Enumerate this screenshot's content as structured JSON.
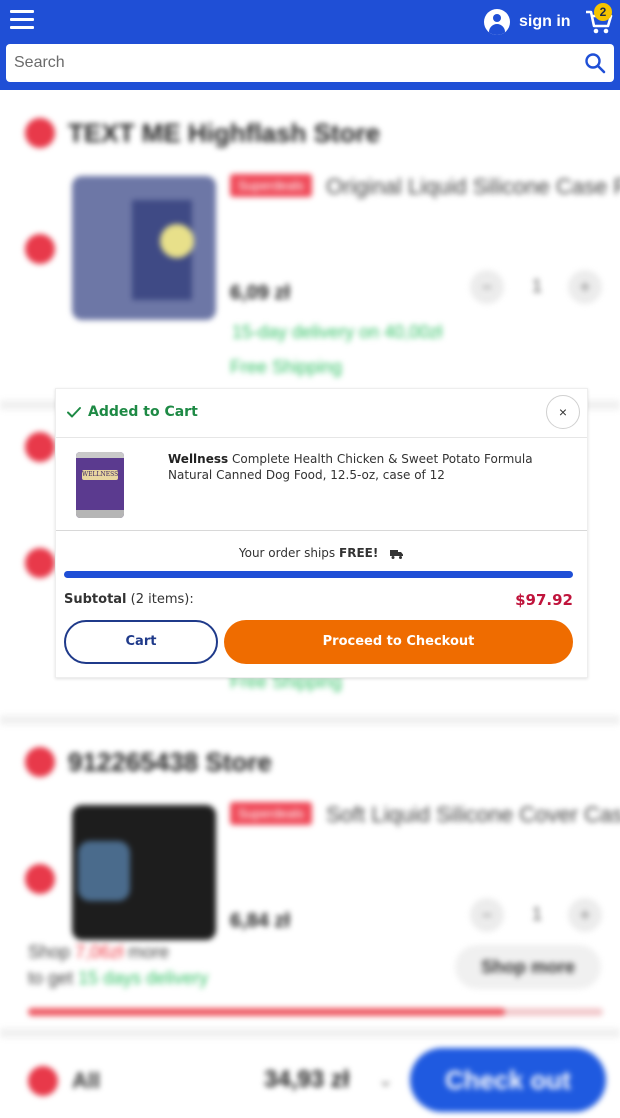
{
  "header": {
    "menu_icon": "hamburger-menu-icon",
    "signin_label": "sign in",
    "cart_count": "2",
    "search_placeholder": "Search"
  },
  "background": {
    "store1": {
      "name": "TEXT ME Highflash Store",
      "tag": "Superdeals",
      "product_title": "Original Liquid Silicone Case F...",
      "price": "6,09 zł",
      "qty": "1",
      "delivery": "15-day delivery on 40,00zł",
      "shipping": "Free Shipping"
    },
    "store2": {
      "shipping": "Free Shipping"
    },
    "store3": {
      "name": "912265438 Store",
      "tag": "Superdeals",
      "product_title": "Soft Liquid Silicone Cover Cas...",
      "price": "6,84 zł",
      "qty": "1"
    },
    "promo": {
      "line1_prefix": "Shop",
      "line1_amount": "7,06zł",
      "line1_suffix": "more",
      "line2_prefix": "to get",
      "line2_delivery": "15 days delivery",
      "shop_more": "Shop more",
      "progress_fraction": 0.83
    },
    "footer": {
      "all_label": "All",
      "total": "34,93 zł",
      "checkout_label": "Check out"
    }
  },
  "modal": {
    "title": "Added to Cart",
    "close_label": "×",
    "product": {
      "brand": "Wellness",
      "description": "Complete Health Chicken & Sweet Potato Formula Natural Canned Dog Food, 12.5-oz, case of 12",
      "image_label": "WELLNESS"
    },
    "ships_prefix": "Your order ships",
    "ships_free": "FREE!",
    "subtotal_label": "Subtotal",
    "subtotal_items": "(2 items):",
    "subtotal_amount": "$97.92",
    "cart_button": "Cart",
    "checkout_button": "Proceed to Checkout"
  },
  "colors": {
    "header_blue": "#1f4fd6",
    "checkout_orange": "#ef6c00",
    "price_red": "#c0143c",
    "success_green": "#1e8a45"
  }
}
